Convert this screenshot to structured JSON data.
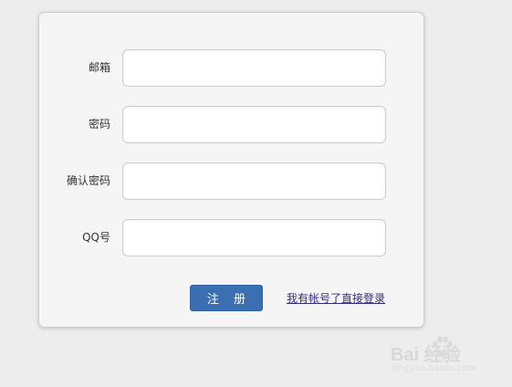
{
  "form": {
    "fields": [
      {
        "label": "邮箱",
        "value": "",
        "placeholder": ""
      },
      {
        "label": "密码",
        "value": "",
        "placeholder": ""
      },
      {
        "label": "确认密码",
        "value": "",
        "placeholder": ""
      },
      {
        "label": "QQ号",
        "value": "",
        "placeholder": ""
      }
    ],
    "submit_label": "注 册",
    "login_link": "我有帐号了直接登录"
  },
  "watermark": {
    "brand": "Bai  经验",
    "url": "jingyan.baidu.com",
    "icon": "paw-icon"
  },
  "colors": {
    "background": "#ededed",
    "card": "#f5f5f5",
    "button": "#3a6fb3",
    "link": "#3a2a7a"
  }
}
